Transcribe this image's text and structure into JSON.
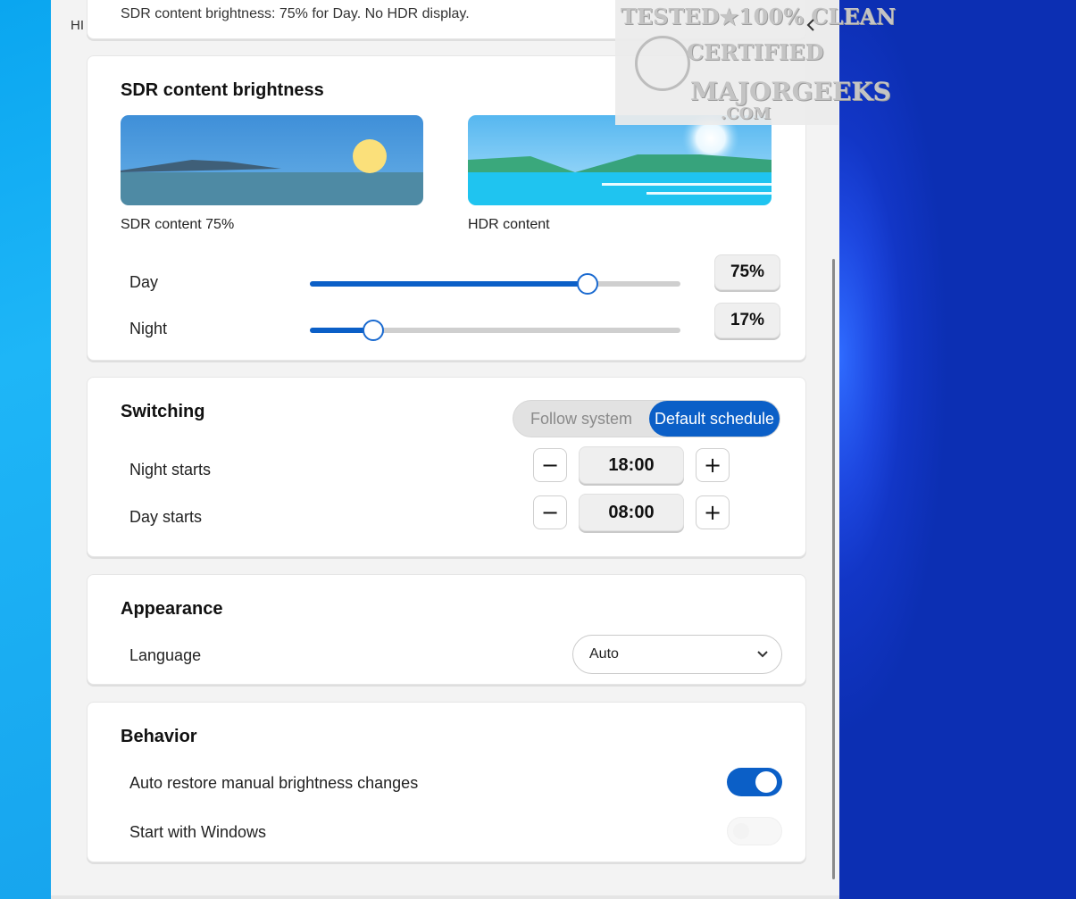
{
  "window": {
    "partial_title": "HI"
  },
  "status": {
    "text": "SDR content brightness: 75% for Day. No HDR display."
  },
  "watermark": {
    "line1": "TESTED★100% CLEAN",
    "line2": "CERTIFIED",
    "line3": "MAJORGEEKS",
    "line4": ".COM"
  },
  "sdr_section": {
    "title": "SDR content brightness",
    "sdr_caption": "SDR content  75%",
    "hdr_caption": "HDR content",
    "day": {
      "label": "Day",
      "value_text": "75%",
      "value": 75
    },
    "night": {
      "label": "Night",
      "value_text": "17%",
      "value": 17
    }
  },
  "switching": {
    "title": "Switching",
    "options": [
      "Follow system",
      "Default schedule"
    ],
    "selected": "Default schedule",
    "night_starts": {
      "label": "Night starts",
      "time": "18:00"
    },
    "day_starts": {
      "label": "Day starts",
      "time": "08:00"
    },
    "minus_glyph": "−",
    "plus_glyph": "+"
  },
  "appearance": {
    "title": "Appearance",
    "language_label": "Language",
    "language_value": "Auto"
  },
  "behavior": {
    "title": "Behavior",
    "auto_restore": {
      "label": "Auto restore manual brightness changes",
      "on": true
    },
    "start_with_windows": {
      "label": "Start with Windows",
      "on": false
    }
  },
  "colors": {
    "accent": "#0b5fc7",
    "desktop_left": "#17a5ee",
    "desktop_right": "#1236c6"
  }
}
